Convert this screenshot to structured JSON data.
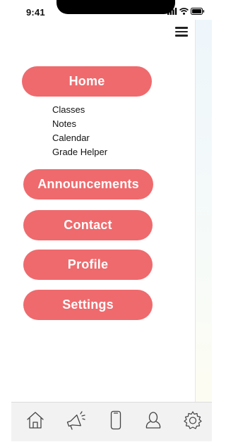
{
  "status_bar": {
    "time": "9:41",
    "icons": [
      "signal-icon",
      "wifi-icon",
      "battery-icon"
    ]
  },
  "header": {
    "menu_icon": "hamburger-icon"
  },
  "nav": {
    "home": "Home",
    "home_submenu": [
      "Classes",
      "Notes",
      "Calendar",
      "Grade Helper"
    ],
    "announcements": "Announcements",
    "contact": "Contact",
    "profile": "Profile",
    "settings": "Settings"
  },
  "tab_bar": {
    "tabs": [
      "home-icon",
      "megaphone-icon",
      "phone-icon",
      "user-icon",
      "gear-icon"
    ]
  },
  "colors": {
    "accent": "#ef6a6d",
    "tab_bar_bg": "#f2f2f2"
  }
}
